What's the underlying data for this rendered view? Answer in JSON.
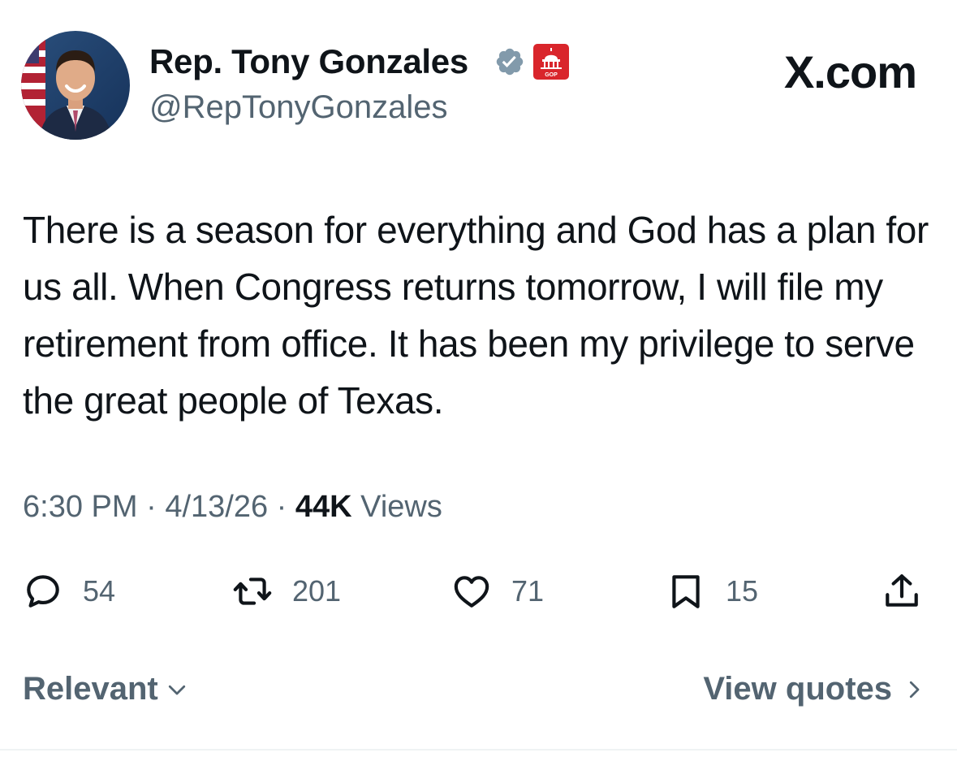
{
  "author": {
    "name": "Rep. Tony Gonzales",
    "handle": "@RepTonyGonzales",
    "avatar_icon": "profile-photo",
    "verified_icon": "verified-badge-icon",
    "affiliation_icon": "house-gop-badge-icon",
    "affiliation_text": "GOP"
  },
  "brand": "X.com",
  "tweet": {
    "text": "There is a season for everything and God has a plan for us all. When Congress returns tomorrow, I will file my retirement from office. It has been my privilege to serve the great people of Texas.",
    "time": "6:30 PM",
    "separator": "·",
    "date": "4/13/26",
    "views_count": "44K",
    "views_label": "Views"
  },
  "actions": {
    "replies": "54",
    "reposts": "201",
    "likes": "71",
    "bookmarks": "15"
  },
  "footer": {
    "sort_label": "Relevant",
    "view_quotes": "View quotes"
  },
  "colors": {
    "text_primary": "#0f1419",
    "text_secondary": "#536471",
    "verified": "#829aab",
    "affiliation_red": "#d9252b"
  }
}
